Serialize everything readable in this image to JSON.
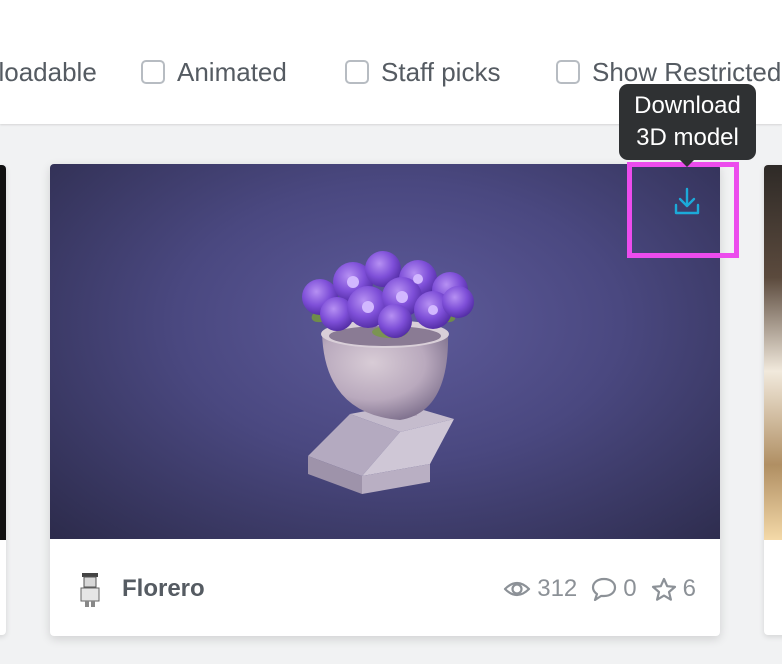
{
  "filters": [
    {
      "label": "Downloadable",
      "checked": false
    },
    {
      "label": "Animated",
      "checked": false
    },
    {
      "label": "Staff picks",
      "checked": false
    },
    {
      "label": "Show Restricted",
      "checked": false
    }
  ],
  "card": {
    "name": "Florero",
    "stats": {
      "views": "312",
      "comments": "0",
      "likes": "6"
    },
    "icons": {
      "views": "eye-icon",
      "comments": "comment-icon",
      "likes": "star-icon",
      "download": "download-icon"
    }
  },
  "tooltip": {
    "line1": "Download",
    "line2": "3D model"
  },
  "colors": {
    "accent_blue": "#1caad9",
    "highlight": "#ec4ced",
    "tooltip_bg": "#2f3133",
    "text_dark": "#555b62",
    "text_muted": "#8c9197"
  }
}
